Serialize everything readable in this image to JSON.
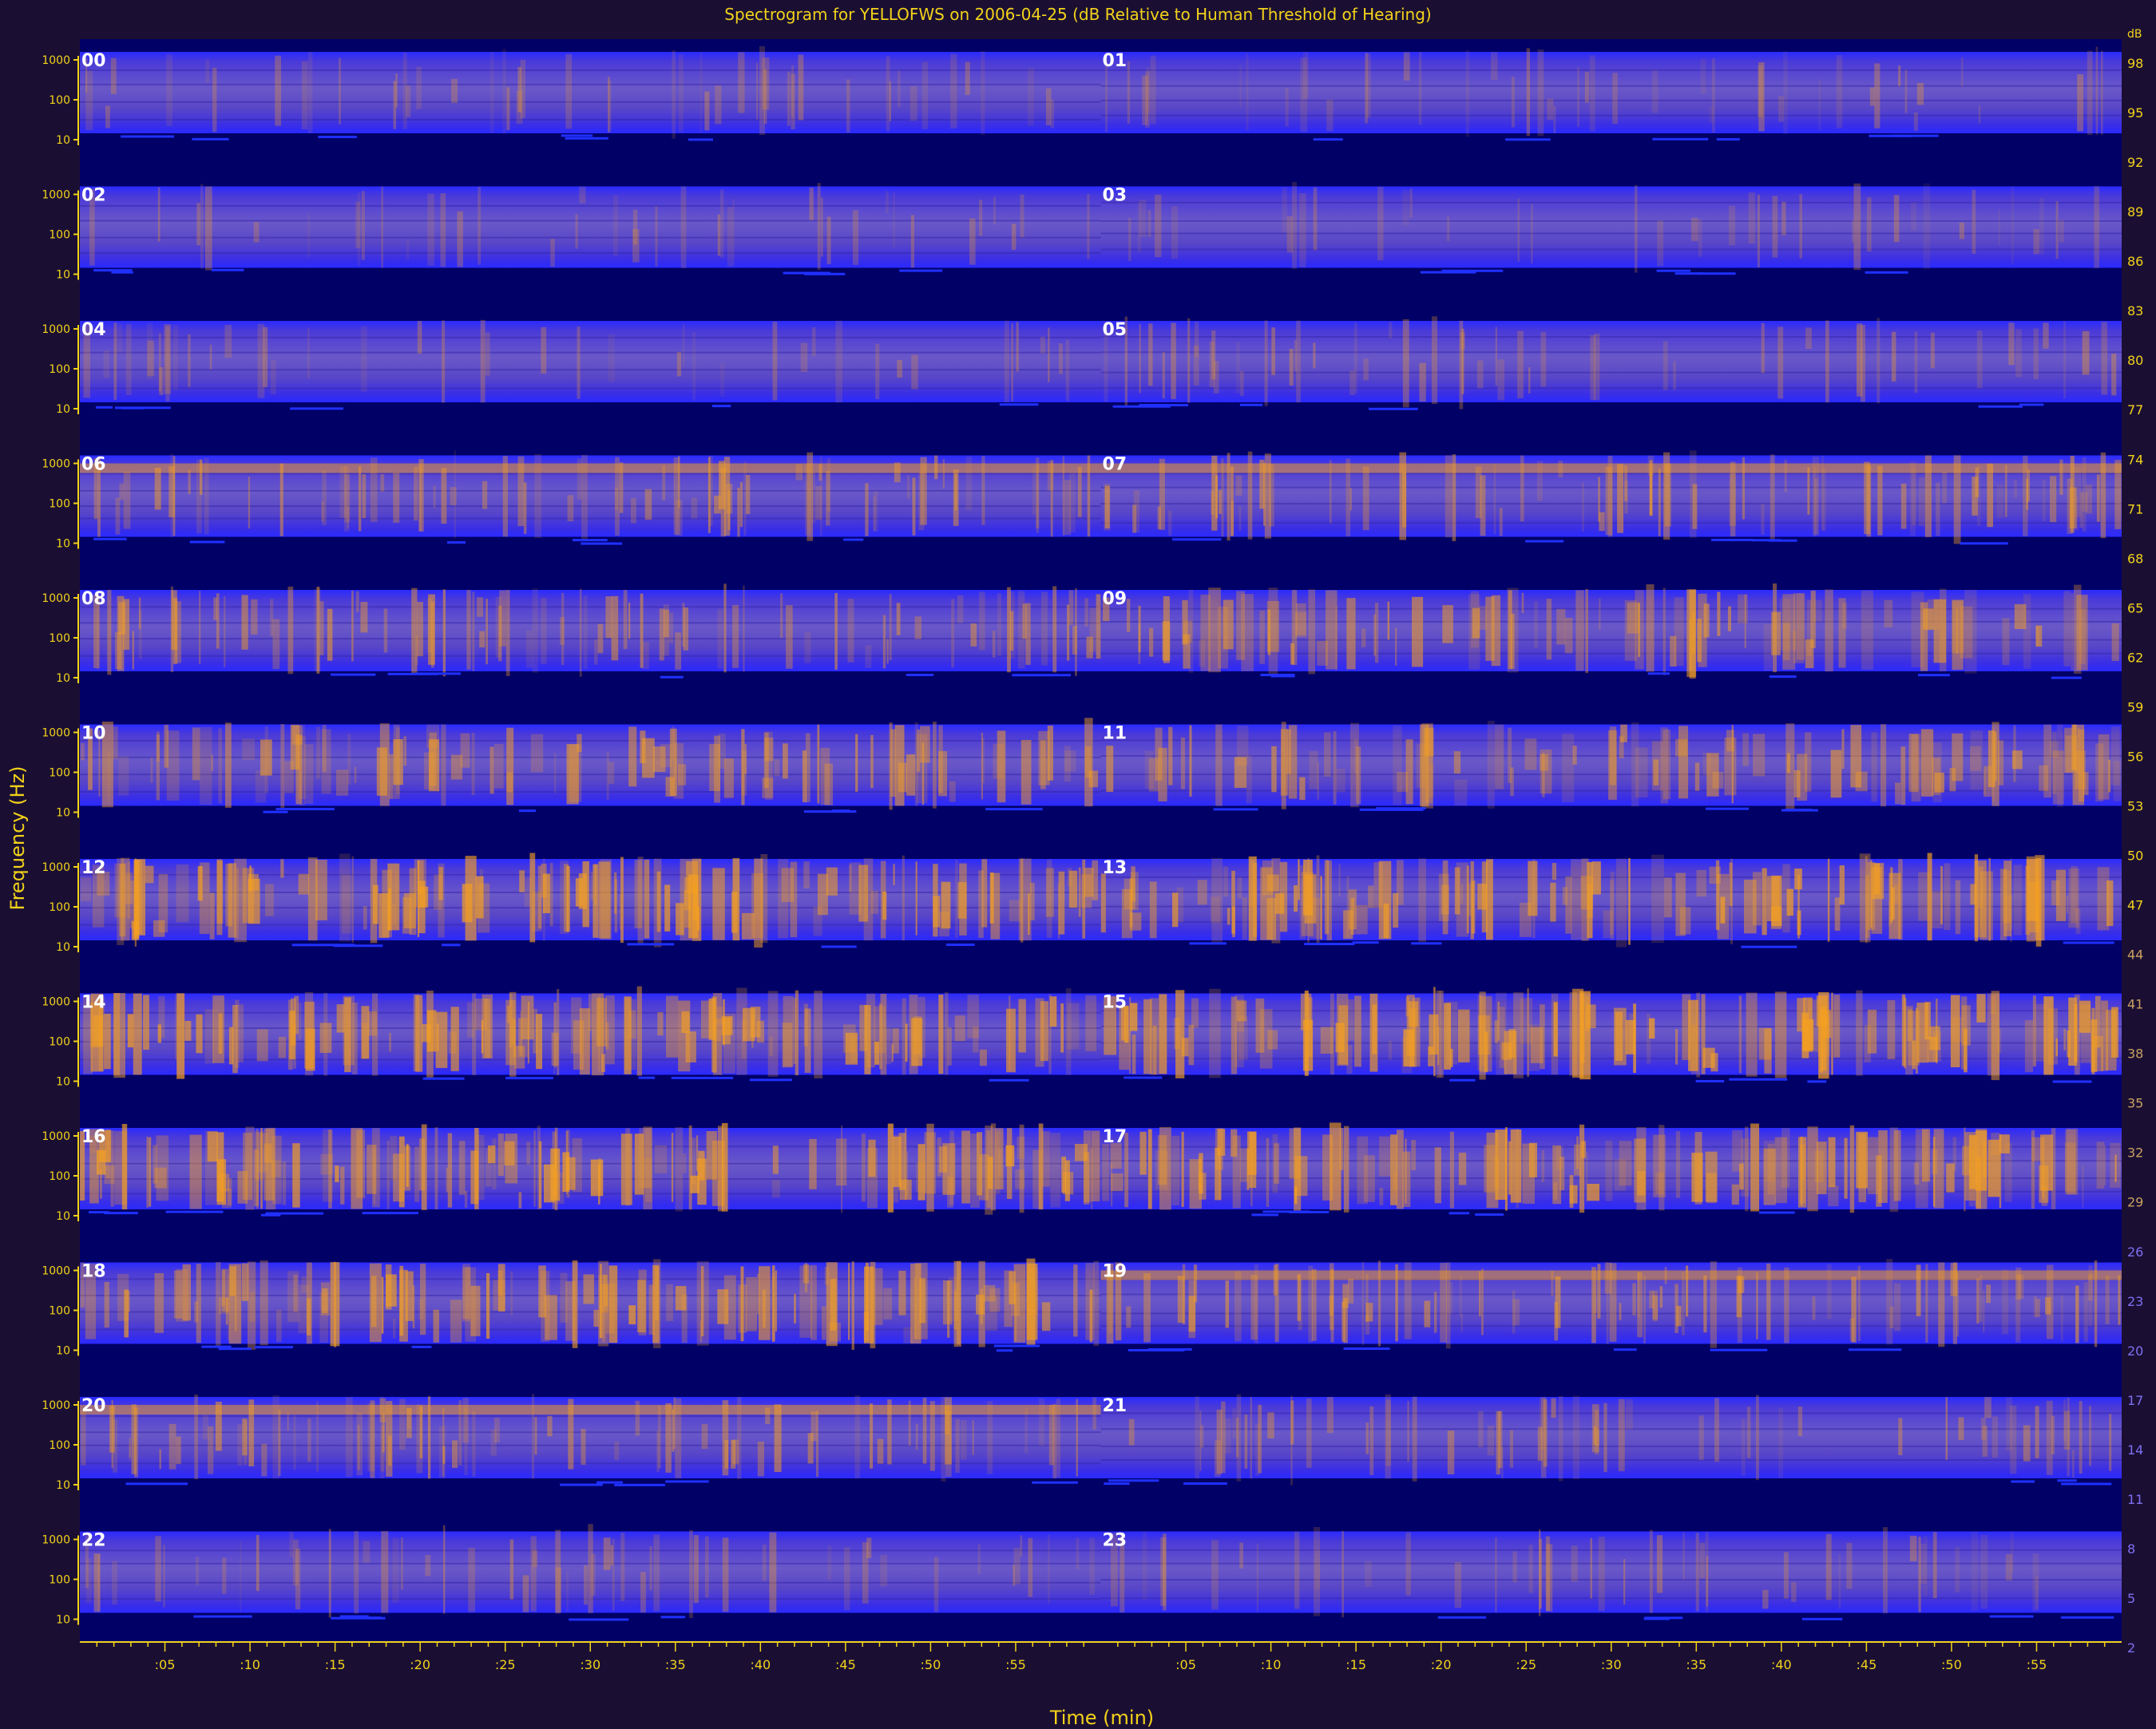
{
  "chart_data": {
    "type": "heatmap",
    "title": "Spectrogram for YELLOFWS on 2006-04-25 (dB Relative to Human Threshold of Hearing)",
    "xlabel": "Time (min)",
    "ylabel": "Frequency (Hz)",
    "x_tick_labels": [
      ":05",
      ":10",
      ":15",
      ":20",
      ":25",
      ":30",
      ":35",
      ":40",
      ":45",
      ":50",
      ":55"
    ],
    "y_tick_labels": [
      "1000",
      "100",
      "10"
    ],
    "colorbar_unit": "dB",
    "colorbar_ticks": [
      98,
      95,
      92,
      89,
      86,
      83,
      80,
      77,
      74,
      71,
      68,
      65,
      62,
      59,
      56,
      53,
      50,
      47,
      44,
      41,
      38,
      35,
      32,
      29,
      26,
      23,
      20,
      17,
      14,
      11,
      8,
      5,
      2
    ],
    "panels": [
      {
        "hour": "00",
        "intensity": 0.18,
        "hot_band": false
      },
      {
        "hour": "01",
        "intensity": 0.16,
        "hot_band": false
      },
      {
        "hour": "02",
        "intensity": 0.12,
        "hot_band": false
      },
      {
        "hour": "03",
        "intensity": 0.12,
        "hot_band": false
      },
      {
        "hour": "04",
        "intensity": 0.14,
        "hot_band": false
      },
      {
        "hour": "05",
        "intensity": 0.22,
        "hot_band": false
      },
      {
        "hour": "06",
        "intensity": 0.42,
        "hot_band": true
      },
      {
        "hour": "07",
        "intensity": 0.45,
        "hot_band": true
      },
      {
        "hour": "08",
        "intensity": 0.48,
        "hot_band": false
      },
      {
        "hour": "09",
        "intensity": 0.52,
        "hot_band": false
      },
      {
        "hour": "10",
        "intensity": 0.55,
        "hot_band": false
      },
      {
        "hour": "11",
        "intensity": 0.55,
        "hot_band": false
      },
      {
        "hour": "12",
        "intensity": 0.75,
        "hot_band": false
      },
      {
        "hour": "13",
        "intensity": 0.78,
        "hot_band": false
      },
      {
        "hour": "14",
        "intensity": 0.78,
        "hot_band": false
      },
      {
        "hour": "15",
        "intensity": 0.8,
        "hot_band": false
      },
      {
        "hour": "16",
        "intensity": 0.8,
        "hot_band": false
      },
      {
        "hour": "17",
        "intensity": 0.75,
        "hot_band": false
      },
      {
        "hour": "18",
        "intensity": 0.72,
        "hot_band": false
      },
      {
        "hour": "19",
        "intensity": 0.5,
        "hot_band": true
      },
      {
        "hour": "20",
        "intensity": 0.45,
        "hot_band": true
      },
      {
        "hour": "21",
        "intensity": 0.3,
        "hot_band": false
      },
      {
        "hour": "22",
        "intensity": 0.22,
        "hot_band": false
      },
      {
        "hour": "23",
        "intensity": 0.18,
        "hot_band": false
      }
    ],
    "colors": {
      "background": "#1a0f33",
      "plot_floor": "#000066",
      "blue_edge": "#2a2aff",
      "mid": "#6a58c8",
      "hot": "#f5a020",
      "axis": "#f2d21a",
      "hour_label": "#ffffff"
    }
  }
}
